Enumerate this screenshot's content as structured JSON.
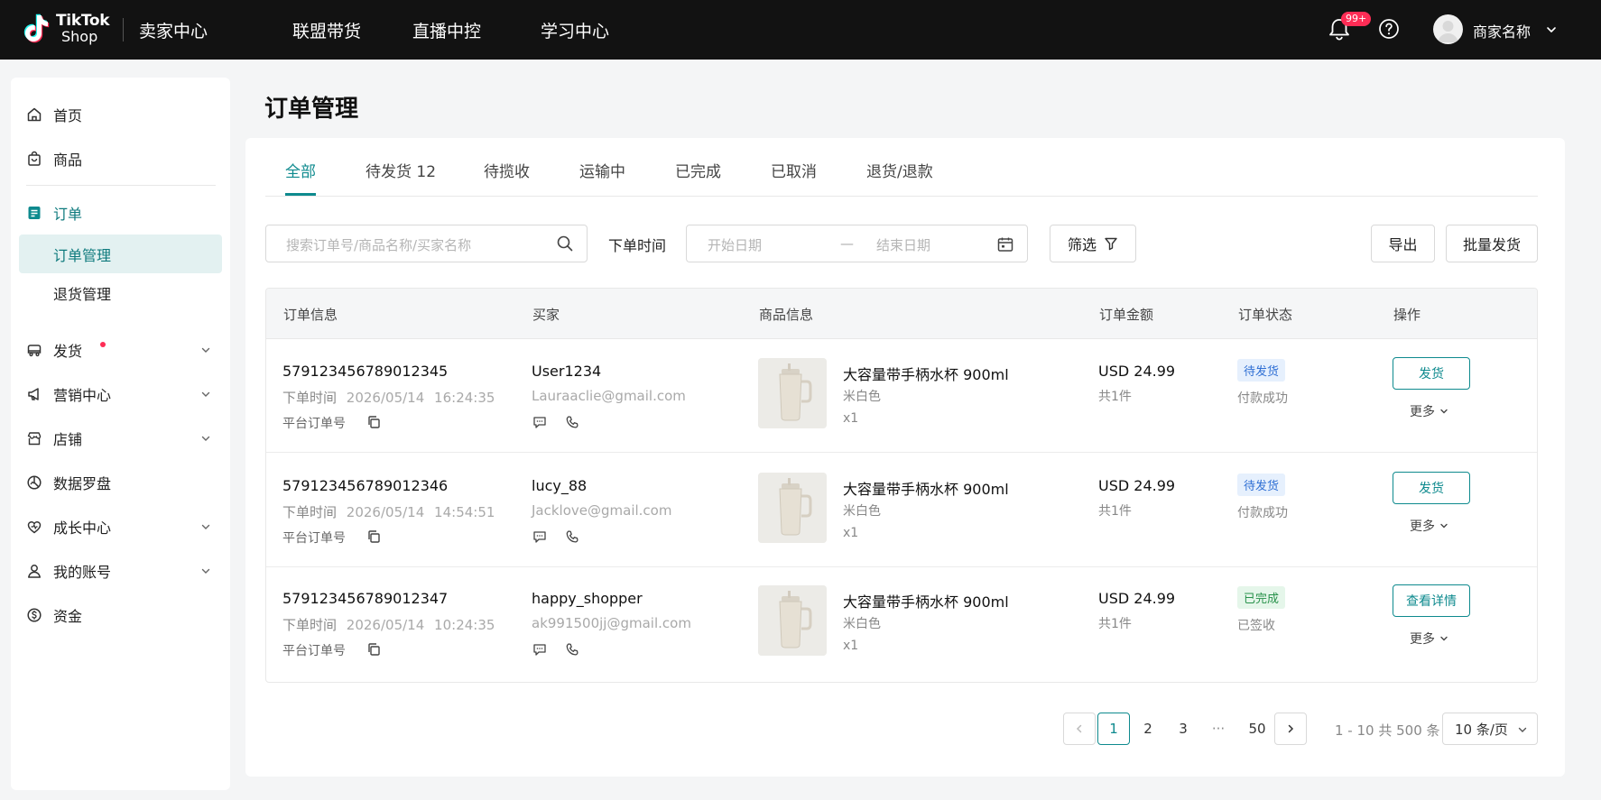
{
  "brand": {
    "logo_line1": "TikTok",
    "logo_line2": "Shop",
    "site_title": "卖家中心"
  },
  "top_nav": [
    "联盟带货",
    "直播中控",
    "学习中心"
  ],
  "header": {
    "notification_badge": "99+",
    "merchant_name": "商家名称"
  },
  "sidebar": {
    "home": "首页",
    "products": "商品",
    "orders": "订单",
    "order_manage": "订单管理",
    "return_manage": "退货管理",
    "shipping": "发货",
    "marketing": "营销中心",
    "store": "店铺",
    "data_compass": "数据罗盘",
    "growth": "成长中心",
    "account": "我的账号",
    "funds": "资金"
  },
  "page_title": "订单管理",
  "tabs": [
    "全部",
    "待发货 12",
    "待揽收",
    "运输中",
    "已完成",
    "已取消",
    "退货/退款"
  ],
  "active_tab": 0,
  "filters": {
    "search_placeholder": "搜索订单号/商品名称/买家名称",
    "time_label": "下单时间",
    "start_placeholder": "开始日期",
    "range_sep": "—",
    "end_placeholder": "结束日期",
    "filter_button": "筛选",
    "export_button": "导出",
    "batch_ship_button": "批量发货"
  },
  "table": {
    "columns": [
      "订单信息",
      "买家",
      "商品信息",
      "订单金额",
      "订单状态",
      "操作"
    ],
    "order_time_label": "下单时间",
    "platform_order_label": "平台订单号",
    "more_label": "更多",
    "rows": [
      {
        "order_id": "579123456789012345",
        "order_date": "2026/05/14",
        "order_clock": "16:24:35",
        "buyer": "User1234",
        "email": "Lauraaclie@gmail.com",
        "product": "大容量带手柄水杯 900ml",
        "variant": "米白色",
        "qty": "x1",
        "amount": "USD 24.99",
        "count": "共1件",
        "status": "待发货",
        "status_kind": "pending",
        "status_sub": "付款成功",
        "action": "发货"
      },
      {
        "order_id": "579123456789012346",
        "order_date": "2026/05/14",
        "order_clock": "14:54:51",
        "buyer": "lucy_88",
        "email": "Jacklove@gmail.com",
        "product": "大容量带手柄水杯 900ml",
        "variant": "米白色",
        "qty": "x1",
        "amount": "USD 24.99",
        "count": "共1件",
        "status": "待发货",
        "status_kind": "pending",
        "status_sub": "付款成功",
        "action": "发货"
      },
      {
        "order_id": "579123456789012347",
        "order_date": "2026/05/14",
        "order_clock": "10:24:35",
        "buyer": "happy_shopper",
        "email": "ak991500jj@gmail.com",
        "product": "大容量带手柄水杯 900ml",
        "variant": "米白色",
        "qty": "x1",
        "amount": "USD 24.99",
        "count": "共1件",
        "status": "已完成",
        "status_kind": "done",
        "status_sub": "已签收",
        "action": "查看详情"
      }
    ]
  },
  "pagination": {
    "pages": [
      "1",
      "2",
      "3",
      "···",
      "50"
    ],
    "current": "1",
    "info": "1 - 10 共 500 条",
    "page_size": "10 条/页"
  },
  "colors": {
    "accent": "#0e8a8e",
    "badge": "#fe2c55",
    "topbar": "#121212"
  }
}
